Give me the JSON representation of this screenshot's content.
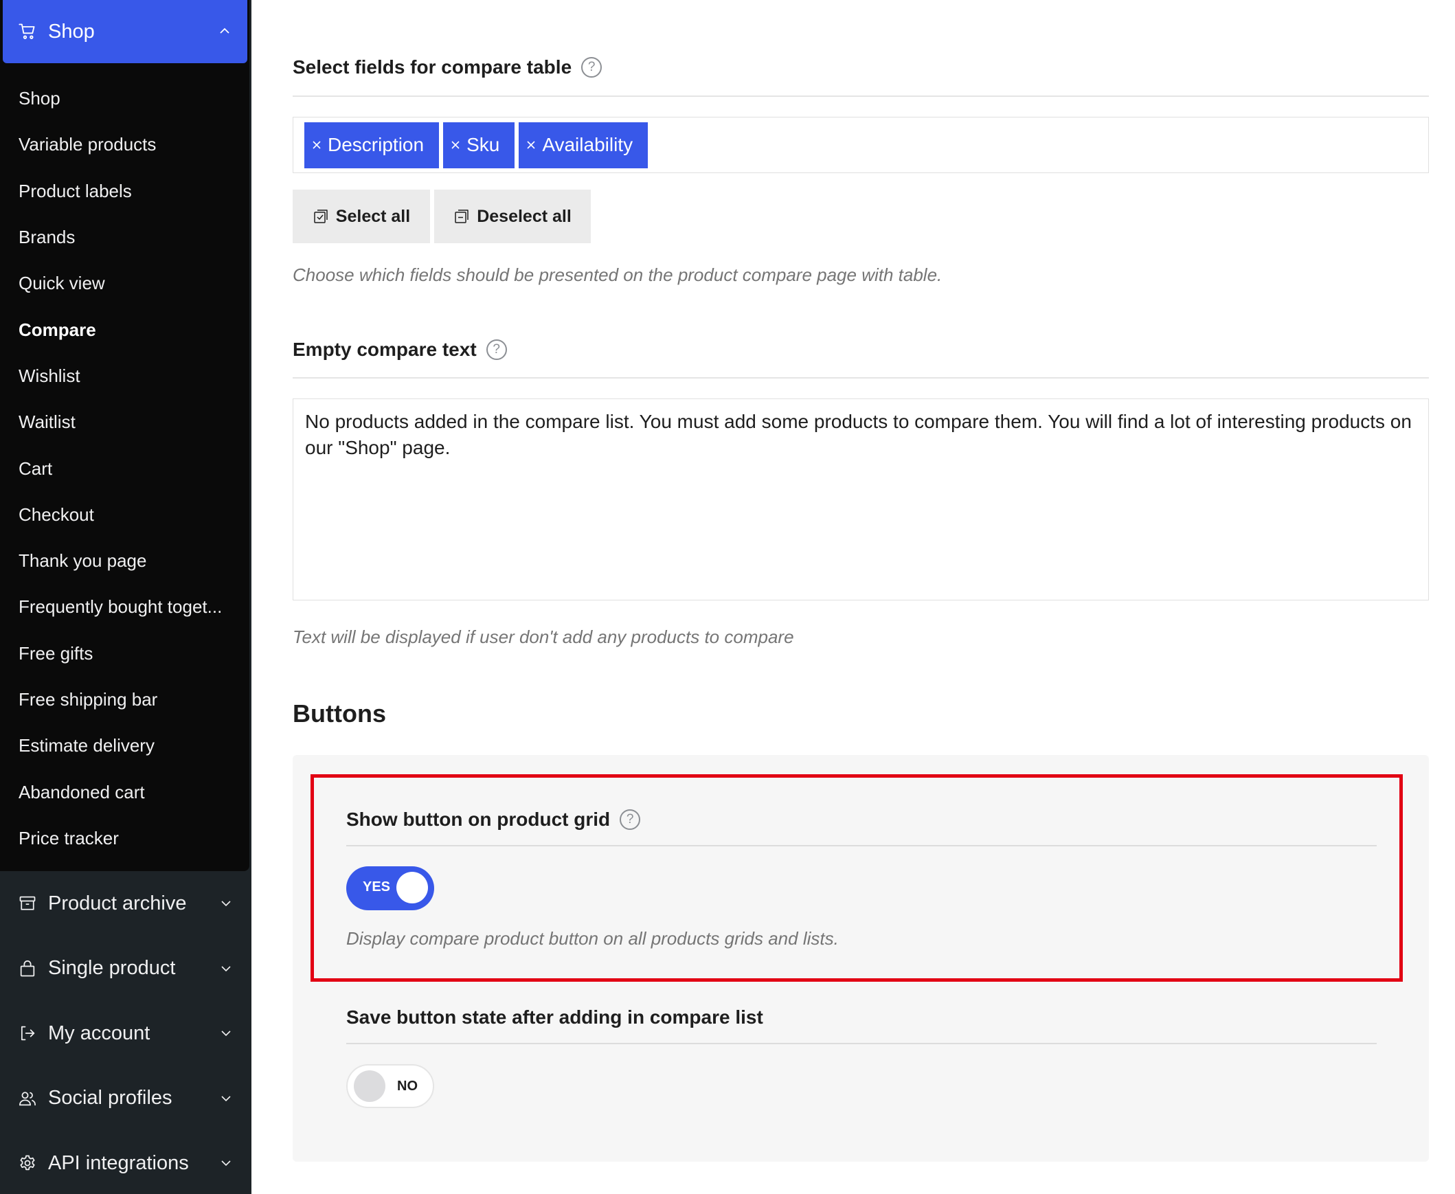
{
  "sidebar": {
    "shop_header": {
      "label": "Shop",
      "icon": "cart-icon",
      "state": "expanded"
    },
    "submenu": [
      {
        "label": "Shop",
        "active": false
      },
      {
        "label": "Variable products",
        "active": false
      },
      {
        "label": "Product labels",
        "active": false
      },
      {
        "label": "Brands",
        "active": false
      },
      {
        "label": "Quick view",
        "active": false
      },
      {
        "label": "Compare",
        "active": true
      },
      {
        "label": "Wishlist",
        "active": false
      },
      {
        "label": "Waitlist",
        "active": false
      },
      {
        "label": "Cart",
        "active": false
      },
      {
        "label": "Checkout",
        "active": false
      },
      {
        "label": "Thank you page",
        "active": false
      },
      {
        "label": "Frequently bought toget...",
        "active": false
      },
      {
        "label": "Free gifts",
        "active": false
      },
      {
        "label": "Free shipping bar",
        "active": false
      },
      {
        "label": "Estimate delivery",
        "active": false
      },
      {
        "label": "Abandoned cart",
        "active": false
      },
      {
        "label": "Price tracker",
        "active": false
      }
    ],
    "menu": [
      {
        "label": "Product archive",
        "icon": "archive-icon"
      },
      {
        "label": "Single product",
        "icon": "bag-icon"
      },
      {
        "label": "My account",
        "icon": "login-icon"
      },
      {
        "label": "Social profiles",
        "icon": "users-icon"
      },
      {
        "label": "API integrations",
        "icon": "gear-icon"
      }
    ]
  },
  "compare_fields": {
    "title": "Select fields for compare table",
    "help": "?",
    "selected": [
      "Description",
      "Sku",
      "Availability"
    ],
    "select_all_label": "Select all",
    "deselect_all_label": "Deselect all",
    "description": "Choose which fields should be presented on the product compare page with table."
  },
  "empty_text": {
    "title": "Empty compare text",
    "help": "?",
    "value": "No products added in the compare list. You must add some products to compare them. You will find a lot of interesting products on our \"Shop\" page.",
    "description": "Text will be displayed if user don't add any products to compare"
  },
  "buttons_section": {
    "title": "Buttons",
    "show_on_grid": {
      "title": "Show button on product grid",
      "help": "?",
      "toggle_label": "YES",
      "enabled": true,
      "description": "Display compare product button on all products grids and lists."
    },
    "save_state": {
      "title": "Save button state after adding in compare list",
      "toggle_label": "NO",
      "enabled": false
    }
  },
  "colors": {
    "accent": "#3858e9",
    "sidebar_bg": "#1d2327",
    "submenu_bg": "#0a0a0a",
    "highlight_border": "#e20013"
  }
}
